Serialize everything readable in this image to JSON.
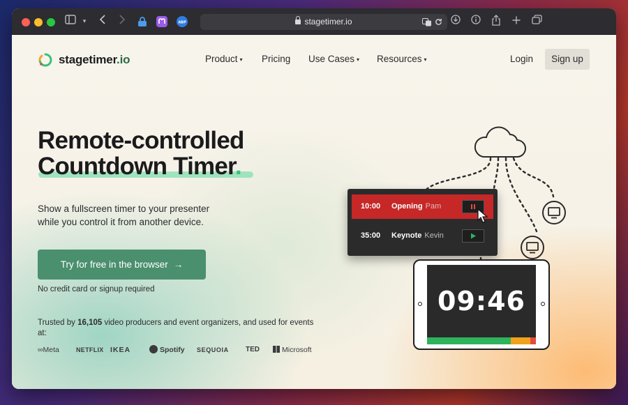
{
  "browser": {
    "url": "stagetimer.io",
    "ext_colors": [
      "#4c9be8",
      "#9a5ce6",
      "#2f7de1"
    ]
  },
  "header": {
    "logo_name": "stagetimer",
    "logo_tld": ".io",
    "nav": [
      {
        "label": "Product",
        "has_menu": true
      },
      {
        "label": "Pricing",
        "has_menu": false
      },
      {
        "label": "Use Cases",
        "has_menu": true
      },
      {
        "label": "Resources",
        "has_menu": true
      }
    ],
    "caret": "▾",
    "login": "Login",
    "signup": "Sign up"
  },
  "hero": {
    "title_line1": "Remote-controlled",
    "title_line2": "Countdown Timer",
    "title_dot": ".",
    "subtitle": "Show a fullscreen timer to your presenter while you control it from another device.",
    "cta_label": "Try for free in the browser",
    "cta_arrow": "→",
    "cta_note": "No credit card or signup required",
    "trusted_prefix": "Trusted by ",
    "trusted_count": "16,105",
    "trusted_suffix": " video producers and event organizers, and used for events at:",
    "brands": [
      "∞Meta",
      "NETFLIX",
      "IKEA",
      "Spotify",
      "SEQUOIA",
      "TED",
      "Microsoft"
    ]
  },
  "illustration": {
    "rows": [
      {
        "time": "10:00",
        "title": "Opening",
        "who": "Pam",
        "state": "paused",
        "color": "#c62828"
      },
      {
        "time": "35:00",
        "title": "Keynote",
        "who": "Kevin",
        "state": "ready",
        "color": "#2b2b2c"
      }
    ],
    "clock": "09:46",
    "colors": {
      "green": "#2fb35c",
      "orange": "#f0a21c",
      "red": "#e44b3c"
    }
  }
}
